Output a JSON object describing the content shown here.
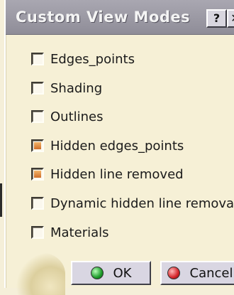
{
  "dialog": {
    "title": "Custom View Modes",
    "help_glyph": "?",
    "close_glyph": "✕"
  },
  "options": [
    {
      "label": "Edges_points",
      "checked": false
    },
    {
      "label": "Shading",
      "checked": false
    },
    {
      "label": "Outlines",
      "checked": false
    },
    {
      "label": "Hidden edges_points",
      "checked": true
    },
    {
      "label": "Hidden line removed",
      "checked": true
    },
    {
      "label": "Dynamic hidden line removal",
      "checked": false
    },
    {
      "label": "Materials",
      "checked": false
    }
  ],
  "buttons": {
    "ok_label": "OK",
    "cancel_label": "Cancel"
  },
  "colors": {
    "titlebar": "#9b99a4",
    "dialog_background": "#f6f0d6",
    "checked_mark": "#e08a3c",
    "ok_icon": "#1d9a2a",
    "cancel_icon": "#d4252a"
  }
}
